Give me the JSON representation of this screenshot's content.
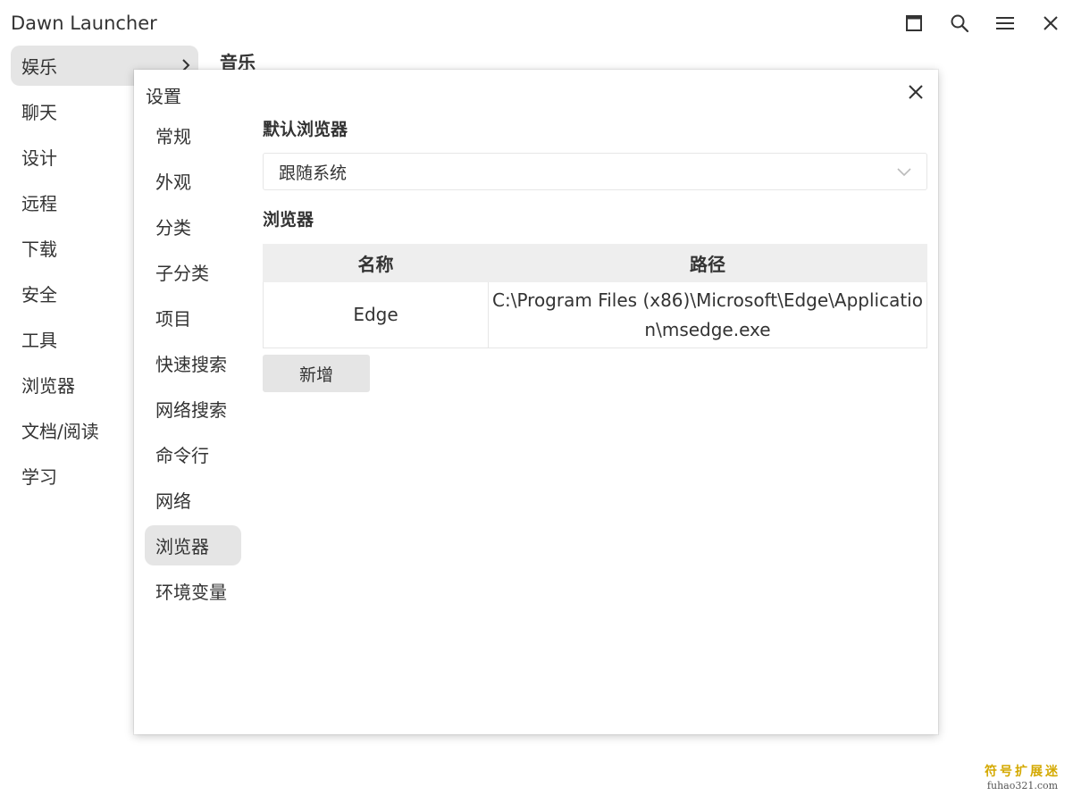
{
  "app": {
    "title": "Dawn Launcher"
  },
  "icons": {
    "maximize": "maximize-icon",
    "search": "search-icon",
    "menu": "menu-icon",
    "close": "close-icon",
    "chevron_right": "chevron-right-icon",
    "chevron_down": "chevron-down-icon"
  },
  "sidebar": {
    "items": [
      {
        "label": "娱乐",
        "active": true
      },
      {
        "label": "聊天"
      },
      {
        "label": "设计"
      },
      {
        "label": "远程"
      },
      {
        "label": "下载"
      },
      {
        "label": "安全"
      },
      {
        "label": "工具"
      },
      {
        "label": "浏览器"
      },
      {
        "label": "文档/阅读"
      },
      {
        "label": "学习"
      }
    ]
  },
  "content": {
    "heading": "音乐"
  },
  "dialog": {
    "title": "设置",
    "nav": [
      {
        "label": "常规"
      },
      {
        "label": "外观"
      },
      {
        "label": "分类"
      },
      {
        "label": "子分类"
      },
      {
        "label": "项目"
      },
      {
        "label": "快速搜索"
      },
      {
        "label": "网络搜索"
      },
      {
        "label": "命令行"
      },
      {
        "label": "网络"
      },
      {
        "label": "浏览器",
        "active": true
      },
      {
        "label": "环境变量"
      }
    ],
    "default_browser_label": "默认浏览器",
    "default_browser_value": "跟随系统",
    "browsers_label": "浏览器",
    "table": {
      "headers": [
        "名称",
        "路径"
      ],
      "rows": [
        {
          "name": "Edge",
          "path": "C:\\Program Files (x86)\\Microsoft\\Edge\\Application\\msedge.exe"
        }
      ]
    },
    "add_button": "新增"
  },
  "watermark": {
    "cn": "符号扩展迷",
    "en": "fuhao321.com"
  }
}
